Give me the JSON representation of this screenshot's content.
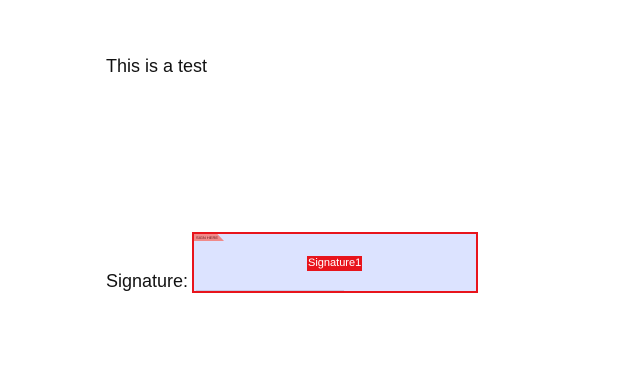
{
  "document": {
    "body_text": "This is a test",
    "signature_label": "Signature:"
  },
  "signature_field": {
    "name": "Signature1",
    "tag_text": "SIGN HERE",
    "border_color": "#e8141c",
    "fill_color": "#d6deff"
  }
}
